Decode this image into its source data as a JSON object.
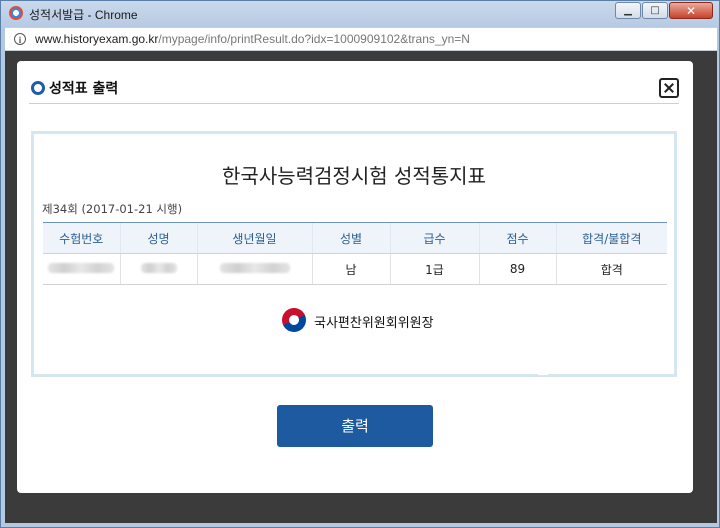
{
  "window": {
    "title": "성적서발급 - Chrome",
    "minimize_label": "▁",
    "maximize_label": "□",
    "close_label": "✕"
  },
  "address": {
    "host": "www.historyexam.go.kr",
    "path": "/mypage/info/printResult.do?idx=1000909102&trans_yn=N"
  },
  "modal": {
    "title": "성적표 출력",
    "report": {
      "title": "한국사능력검정시험 성적통지표",
      "exam_info": "제34회 (2017-01-21 시행)",
      "columns": [
        "수험번호",
        "성명",
        "생년월일",
        "성별",
        "급수",
        "점수",
        "합격/불합격"
      ],
      "row": {
        "gender": "남",
        "grade": "1급",
        "score": "89",
        "result": "합격"
      },
      "issuer": "국사편찬위원회위원장"
    },
    "print_button": "출력"
  }
}
